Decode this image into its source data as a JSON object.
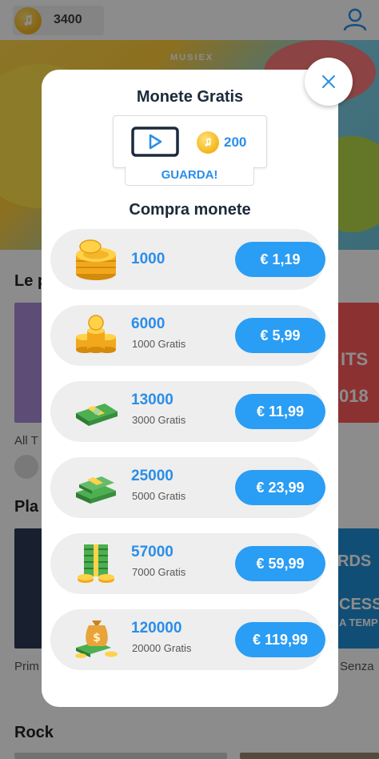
{
  "header": {
    "coin_count": "3400"
  },
  "hero": {
    "brand": "MUSIEX"
  },
  "background": {
    "section_le": "Le p",
    "thumb_label_1": "All T",
    "section_pla": "Pla",
    "thumb_label_2": "Prim",
    "thumb_label_3": "Senza",
    "section_rock": "Rock",
    "banner_text_1": "ITS",
    "banner_text_2": "018",
    "banner_text_3": "RDS",
    "banner_text_4": "CESS",
    "banner_text_5": "A TEMP"
  },
  "modal": {
    "title": "Monete Gratis",
    "free_coins": "200",
    "watch_label": "GUARDA!",
    "buy_title": "Compra monete",
    "packs": [
      {
        "amount": "1000",
        "bonus": "",
        "price": "€ 1,19",
        "icon": "coin-stack-icon"
      },
      {
        "amount": "6000",
        "bonus": "1000 Gratis",
        "price": "€ 5,99",
        "icon": "coin-pile-icon"
      },
      {
        "amount": "13000",
        "bonus": "3000 Gratis",
        "price": "€ 11,99",
        "icon": "cash-bundle-icon"
      },
      {
        "amount": "25000",
        "bonus": "5000 Gratis",
        "price": "€ 23,99",
        "icon": "cash-stacks-icon"
      },
      {
        "amount": "57000",
        "bonus": "7000 Gratis",
        "price": "€ 59,99",
        "icon": "cash-tower-icon"
      },
      {
        "amount": "120000",
        "bonus": "20000 Gratis",
        "price": "€ 119,99",
        "icon": "money-bag-icon"
      }
    ]
  },
  "colors": {
    "accent": "#2a9df4",
    "accent_text": "#2a8ee8",
    "title_text": "#1b2a3b",
    "row_bg": "#eeeeee"
  }
}
